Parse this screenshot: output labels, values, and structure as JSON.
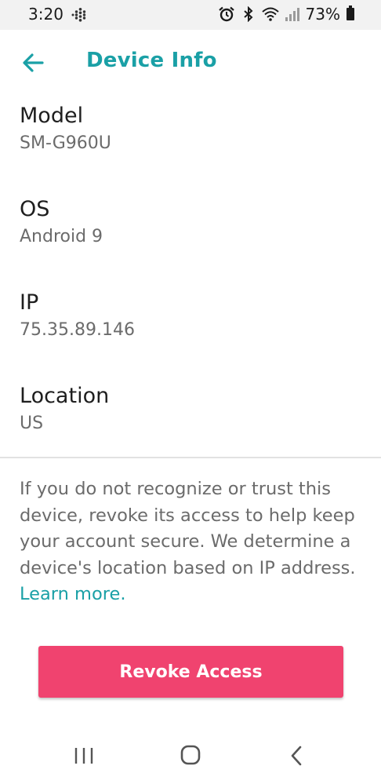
{
  "status_bar": {
    "time": "3:20",
    "battery_percent": "73%",
    "icons": [
      "fitbit-dots-icon",
      "alarm-icon",
      "bluetooth-icon",
      "wifi-icon",
      "signal-icon",
      "battery-icon"
    ]
  },
  "header": {
    "title": "Device Info",
    "back_icon": "arrow-left-icon",
    "accent_color": "#1aa0a6"
  },
  "info": [
    {
      "label": "Model",
      "value": "SM-G960U"
    },
    {
      "label": "OS",
      "value": "Android 9"
    },
    {
      "label": "IP",
      "value": "75.35.89.146"
    },
    {
      "label": "Location",
      "value": "US"
    }
  ],
  "notice": {
    "text": "If you do not recognize or trust this device, revoke its access to help keep your account secure. We determine a device's location based on IP address.",
    "link": "Learn more."
  },
  "revoke_button": {
    "label": "Revoke Access",
    "color": "#f0436f"
  },
  "nav_bar": {
    "icons": [
      "recents-icon",
      "home-icon",
      "back-nav-icon"
    ]
  }
}
